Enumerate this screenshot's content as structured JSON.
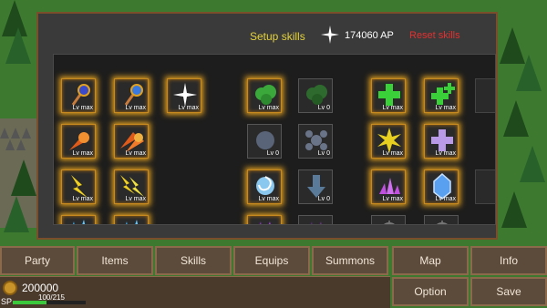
{
  "header": {
    "setup_label": "Setup skills",
    "ap_value": "174060 AP",
    "reset_label": "Reset skills"
  },
  "skills": [
    {
      "icon": "fire-orb-staff-icon",
      "level": "Lv max",
      "state": "max"
    },
    {
      "icon": "water-orb-staff-icon",
      "level": "Lv max",
      "state": "max"
    },
    {
      "icon": "star-sparkle-icon",
      "level": "Lv max",
      "state": "max"
    },
    {
      "icon": "green-cloud-icon",
      "level": "Lv max",
      "state": "max"
    },
    {
      "icon": "green-cloud-icon",
      "level": "Lv 0",
      "state": "min"
    },
    {
      "icon": "green-cross-icon",
      "level": "Lv max",
      "state": "max"
    },
    {
      "icon": "green-cross-plus-icon",
      "level": "Lv max",
      "state": "max"
    },
    {
      "icon": "fireball-icon",
      "level": "Lv max",
      "state": "max"
    },
    {
      "icon": "double-fireball-icon",
      "level": "Lv max",
      "state": "max"
    },
    {
      "icon": "grey-orb-icon",
      "level": "Lv 0",
      "state": "min"
    },
    {
      "icon": "orb-cluster-icon",
      "level": "Lv 0",
      "state": "min"
    },
    {
      "icon": "yellow-burst-icon",
      "level": "Lv max",
      "state": "max"
    },
    {
      "icon": "purple-cross-icon",
      "level": "Lv max",
      "state": "max"
    },
    {
      "icon": "lightning-icon",
      "level": "Lv max",
      "state": "max"
    },
    {
      "icon": "double-lightning-icon",
      "level": "Lv max",
      "state": "max"
    },
    {
      "icon": "ice-swirl-icon",
      "level": "Lv max",
      "state": "max"
    },
    {
      "icon": "blue-arrow-down-icon",
      "level": "Lv 0",
      "state": "min"
    },
    {
      "icon": "purple-shards-icon",
      "level": "Lv max",
      "state": "max"
    },
    {
      "icon": "blue-crystal-icon",
      "level": "Lv max",
      "state": "max"
    },
    {
      "icon": "ice-spikes-icon",
      "level": "",
      "state": "max"
    },
    {
      "icon": "ice-spikes-icon",
      "level": "",
      "state": "max"
    },
    {
      "icon": "dark-spikes-icon",
      "level": "",
      "state": "max"
    },
    {
      "icon": "dark-spikes-icon",
      "level": "",
      "state": "min"
    },
    {
      "icon": "crosshair-icon",
      "level": "",
      "state": "min"
    },
    {
      "icon": "crosshair-icon",
      "level": "",
      "state": "min"
    }
  ],
  "nav": {
    "party": "Party",
    "items": "Items",
    "skills": "Skills",
    "equips": "Equips",
    "summons": "Summons",
    "map": "Map",
    "info": "Info",
    "option": "Option",
    "save": "Save"
  },
  "status": {
    "gold": "200000",
    "sp_label": "SP",
    "sp_text": "100/215",
    "sp_fraction": 0.465
  },
  "colors": {
    "accent_gold": "#e4d23b",
    "reset_red": "#e23030",
    "glow": "#e0a020",
    "sp_bar": "#3cc83c"
  }
}
